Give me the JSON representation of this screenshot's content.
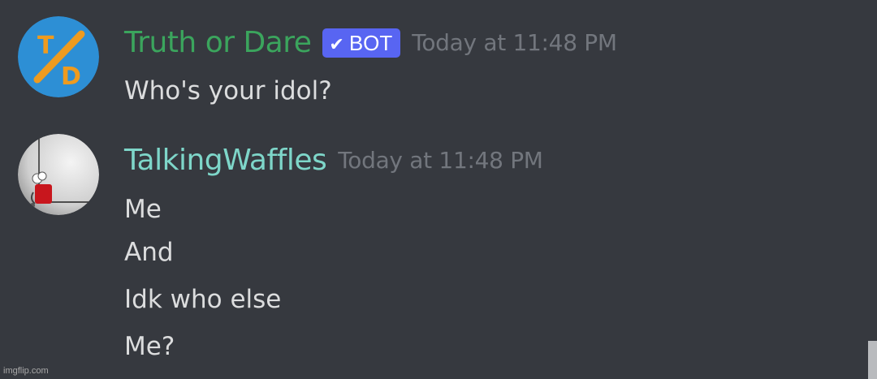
{
  "messages": [
    {
      "author": "Truth or Dare",
      "author_color": "#3ba55d",
      "bot_tag": "BOT",
      "verified_icon": "check-icon",
      "timestamp": "Today at 11:48 PM",
      "avatar": {
        "icon": "truth-or-dare-logo",
        "bg_color": "#2d8fd5",
        "accent_color": "#ee9b1f",
        "letters": [
          "T",
          "D"
        ]
      },
      "lines": [
        "Who's your idol?"
      ]
    },
    {
      "author": "TalkingWaffles",
      "author_color": "#7ed6c9",
      "timestamp": "Today at 11:48 PM",
      "avatar": {
        "icon": "user-avatar-image",
        "bg_color": "#d8d8d8"
      },
      "lines": [
        "Me",
        "And",
        "Idk who else",
        "Me?"
      ]
    }
  ],
  "colors": {
    "background": "#36393f",
    "message_text": "#dcddde",
    "timestamp": "#72767d",
    "bot_tag": "#5865f2"
  },
  "watermark": "imgflip.com"
}
